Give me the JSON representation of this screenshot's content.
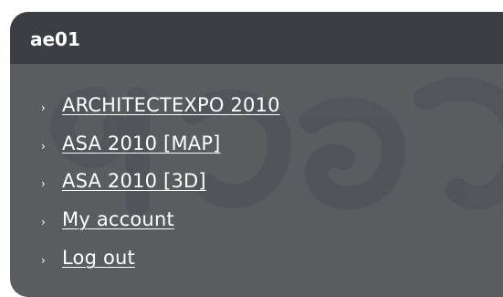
{
  "block": {
    "title": "ae01",
    "bullet_glyph": "›",
    "items": [
      {
        "label": "ARCHITECTEXPO 2010"
      },
      {
        "label": "ASA 2010 [MAP]"
      },
      {
        "label": "ASA 2010 [3D]"
      },
      {
        "label": "My account"
      },
      {
        "label": "Log out"
      }
    ]
  },
  "colors": {
    "panel_background": "#595d60",
    "header_background": "#3b3e42",
    "text": "#ffffff",
    "watermark": "#51555a"
  },
  "icons": {
    "bullet": "chevron-right-icon",
    "watermark": "thai-script-watermark"
  }
}
